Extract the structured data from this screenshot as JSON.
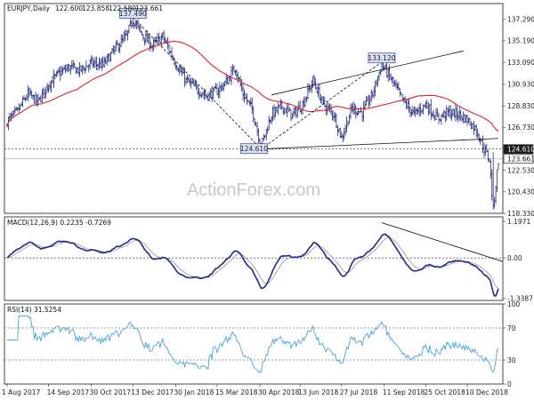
{
  "chart_data": [
    {
      "type": "ohlc",
      "symbol": "EURJPY,Daily",
      "readout": {
        "open": "122.600",
        "high": "123.858",
        "low": "122.580",
        "close": "123.661"
      },
      "ylim": [
        118.33,
        138.83
      ],
      "yticks": [
        {
          "v": 137.29,
          "t": "137.290"
        },
        {
          "v": 135.19,
          "t": "135.190"
        },
        {
          "v": 133.09,
          "t": "133.090"
        },
        {
          "v": 130.93,
          "t": "130.930"
        },
        {
          "v": 128.83,
          "t": "128.830"
        },
        {
          "v": 126.73,
          "t": "126.730"
        },
        {
          "v": 124.63,
          "t": "124.630"
        },
        {
          "v": 122.53,
          "t": "122.530"
        },
        {
          "v": 120.43,
          "t": "120.430"
        },
        {
          "v": 118.33,
          "t": "118.330"
        }
      ],
      "price_labels": [
        {
          "v": 124.61,
          "t": "124.610",
          "style": "dark"
        },
        {
          "v": 123.661,
          "t": "123.661",
          "style": "current"
        }
      ],
      "annotations": [
        {
          "text": "137.490",
          "value": 137.49,
          "date_index": 97
        },
        {
          "text": "133.120",
          "value": 133.12,
          "date_index": 289
        },
        {
          "text": "124.610",
          "value": 124.61,
          "date_index": 196
        }
      ],
      "watermark": "ActionForex.com",
      "moving_average": {
        "color": "#e0232a"
      },
      "bar_color": "#1f2a7a"
    },
    {
      "type": "line",
      "name": "MACD(12,26,9) 0.2235 -0.7269",
      "ylim": [
        -1.4,
        1.35
      ],
      "yticks": [
        {
          "v": 1.1971,
          "t": "1.1971"
        },
        {
          "v": 0,
          "t": "0.00"
        },
        {
          "v": -1.3387,
          "t": "-1.3387"
        }
      ],
      "zero_line": true,
      "colors": {
        "macd": "#1f2a8a",
        "signal": "#a0a0a0",
        "trendline": "#000000"
      }
    },
    {
      "type": "line",
      "name": "RSI(14) 31.5254",
      "ylim": [
        0,
        100
      ],
      "yticks": [
        {
          "v": 100,
          "t": "100"
        },
        {
          "v": 70,
          "t": "70"
        },
        {
          "v": 30,
          "t": "30"
        },
        {
          "v": 0,
          "t": "0"
        }
      ],
      "levels": [
        70,
        30
      ],
      "color": "#4aa3d8"
    }
  ],
  "x_axis": {
    "labels": [
      {
        "t": "1 Aug 2017",
        "i": 0
      },
      {
        "t": "14 Sep 2017",
        "i": 32
      },
      {
        "t": "30 Oct 2017",
        "i": 65
      },
      {
        "t": "13 Dec 2017",
        "i": 97
      },
      {
        "t": "30 Jan 2018",
        "i": 130
      },
      {
        "t": "15 Mar 2018",
        "i": 162
      },
      {
        "t": "30 Apr 2018",
        "i": 195
      },
      {
        "t": "13 Jun 2018",
        "i": 226
      },
      {
        "t": "27 Jul 2018",
        "i": 258
      },
      {
        "t": "11 Sep 2018",
        "i": 291
      },
      {
        "t": "25 Oct 2018",
        "i": 323
      },
      {
        "t": "10 Dec 2018",
        "i": 355
      }
    ]
  }
}
